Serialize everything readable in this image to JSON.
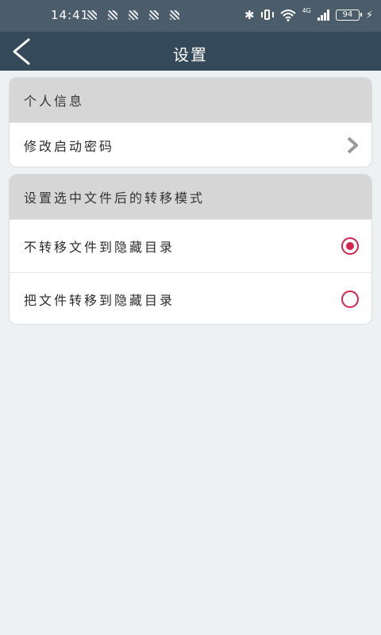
{
  "status_bar": {
    "time": "14:41",
    "network": "4G",
    "battery": "94"
  },
  "header": {
    "title": "设置"
  },
  "personal_section": {
    "header": "个人信息",
    "items": [
      {
        "label": "修改启动密码"
      }
    ]
  },
  "transfer_section": {
    "header": "设置选中文件后的转移模式",
    "options": [
      {
        "label": "不转移文件到隐藏目录",
        "selected": true
      },
      {
        "label": "把文件转移到隐藏目录",
        "selected": false
      }
    ]
  },
  "colors": {
    "accent": "#d7244f",
    "title_bar": "#34495a",
    "status_bar": "#4b5c6b"
  }
}
